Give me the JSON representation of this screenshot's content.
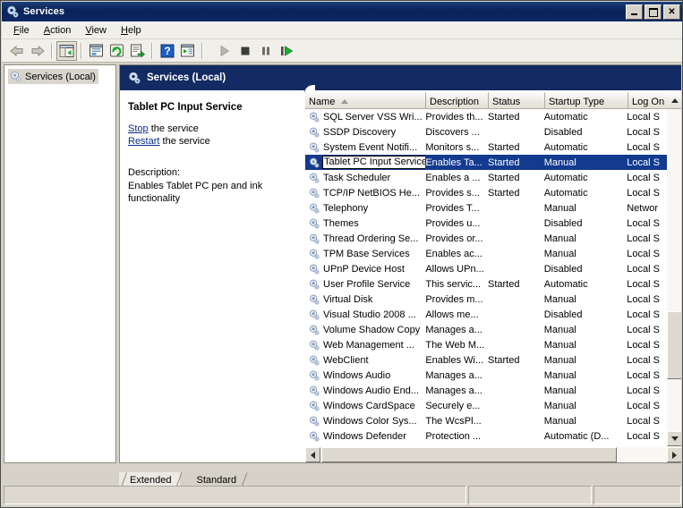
{
  "window": {
    "title": "Services",
    "icon": "services-gear-icon",
    "minimize_label": "Minimize",
    "maximize_label": "Maximize",
    "close_label": "Close"
  },
  "menu": {
    "items": [
      {
        "label": "File",
        "accel": "F"
      },
      {
        "label": "Action",
        "accel": "A"
      },
      {
        "label": "View",
        "accel": "V"
      },
      {
        "label": "Help",
        "accel": "H"
      }
    ]
  },
  "toolbar": {
    "buttons": [
      {
        "name": "back-icon",
        "label": "Back",
        "enabled": false
      },
      {
        "name": "forward-icon",
        "label": "Forward",
        "enabled": false
      },
      {
        "name": "show-hide-tree-icon",
        "label": "Show/Hide Console Tree",
        "enabled": true
      },
      {
        "name": "properties-icon",
        "label": "Properties",
        "enabled": true
      },
      {
        "name": "refresh-icon",
        "label": "Refresh",
        "enabled": true
      },
      {
        "name": "export-list-icon",
        "label": "Export List",
        "enabled": true
      },
      {
        "name": "help-icon",
        "label": "Help",
        "enabled": true
      },
      {
        "name": "new-window-icon",
        "label": "New Window from Here",
        "enabled": true
      },
      {
        "name": "start-service-icon",
        "label": "Start Service",
        "enabled": false
      },
      {
        "name": "stop-service-icon",
        "label": "Stop Service",
        "enabled": false
      },
      {
        "name": "pause-service-icon",
        "label": "Pause Service",
        "enabled": false
      },
      {
        "name": "restart-service-icon",
        "label": "Restart Service",
        "enabled": true
      }
    ]
  },
  "tree": {
    "root_label": "Services (Local)",
    "root_icon": "services-gear-icon"
  },
  "right_panel": {
    "header_title": "Services (Local)",
    "header_icon": "services-gear-icon",
    "header_bg": "#132b62",
    "selected_service_title": "Tablet PC Input Service",
    "actions": [
      {
        "link": "Stop",
        "suffix": " the service"
      },
      {
        "link": "Restart",
        "suffix": " the service"
      }
    ],
    "description_label": "Description:",
    "description_text": "Enables Tablet PC pen and ink functionality"
  },
  "list": {
    "columns": [
      {
        "key": "name",
        "label": "Name",
        "sort": "asc"
      },
      {
        "key": "description",
        "label": "Description",
        "sort": ""
      },
      {
        "key": "status",
        "label": "Status",
        "sort": ""
      },
      {
        "key": "startup",
        "label": "Startup Type",
        "sort": ""
      },
      {
        "key": "logon",
        "label": "Log On",
        "sort": ""
      }
    ],
    "rows": [
      {
        "name": "SQL Server VSS Wri...",
        "description": "Provides th...",
        "status": "Started",
        "startup": "Automatic",
        "logon": "Local S",
        "selected": false
      },
      {
        "name": "SSDP Discovery",
        "description": "Discovers ...",
        "status": "",
        "startup": "Disabled",
        "logon": "Local S",
        "selected": false
      },
      {
        "name": "System Event Notifi...",
        "description": "Monitors s...",
        "status": "Started",
        "startup": "Automatic",
        "logon": "Local S",
        "selected": false
      },
      {
        "name": "Tablet PC Input Service",
        "description": "Enables Ta...",
        "status": "Started",
        "startup": "Manual",
        "logon": "Local S",
        "selected": true
      },
      {
        "name": "Task Scheduler",
        "description": "Enables a ...",
        "status": "Started",
        "startup": "Automatic",
        "logon": "Local S",
        "selected": false
      },
      {
        "name": "TCP/IP NetBIOS He...",
        "description": "Provides s...",
        "status": "Started",
        "startup": "Automatic",
        "logon": "Local S",
        "selected": false
      },
      {
        "name": "Telephony",
        "description": "Provides T...",
        "status": "",
        "startup": "Manual",
        "logon": "Networ",
        "selected": false
      },
      {
        "name": "Themes",
        "description": "Provides u...",
        "status": "",
        "startup": "Disabled",
        "logon": "Local S",
        "selected": false
      },
      {
        "name": "Thread Ordering Se...",
        "description": "Provides or...",
        "status": "",
        "startup": "Manual",
        "logon": "Local S",
        "selected": false
      },
      {
        "name": "TPM Base Services",
        "description": "Enables ac...",
        "status": "",
        "startup": "Manual",
        "logon": "Local S",
        "selected": false
      },
      {
        "name": "UPnP Device Host",
        "description": "Allows UPn...",
        "status": "",
        "startup": "Disabled",
        "logon": "Local S",
        "selected": false
      },
      {
        "name": "User Profile Service",
        "description": "This servic...",
        "status": "Started",
        "startup": "Automatic",
        "logon": "Local S",
        "selected": false
      },
      {
        "name": "Virtual Disk",
        "description": "Provides m...",
        "status": "",
        "startup": "Manual",
        "logon": "Local S",
        "selected": false
      },
      {
        "name": "Visual Studio 2008 ...",
        "description": "Allows me...",
        "status": "",
        "startup": "Disabled",
        "logon": "Local S",
        "selected": false
      },
      {
        "name": "Volume Shadow Copy",
        "description": "Manages a...",
        "status": "",
        "startup": "Manual",
        "logon": "Local S",
        "selected": false
      },
      {
        "name": "Web Management ...",
        "description": "The Web M...",
        "status": "",
        "startup": "Manual",
        "logon": "Local S",
        "selected": false
      },
      {
        "name": "WebClient",
        "description": "Enables Wi...",
        "status": "Started",
        "startup": "Manual",
        "logon": "Local S",
        "selected": false
      },
      {
        "name": "Windows Audio",
        "description": "Manages a...",
        "status": "",
        "startup": "Manual",
        "logon": "Local S",
        "selected": false
      },
      {
        "name": "Windows Audio End...",
        "description": "Manages a...",
        "status": "",
        "startup": "Manual",
        "logon": "Local S",
        "selected": false
      },
      {
        "name": "Windows CardSpace",
        "description": "Securely e...",
        "status": "",
        "startup": "Manual",
        "logon": "Local S",
        "selected": false
      },
      {
        "name": "Windows Color Sys...",
        "description": "The WcsPl...",
        "status": "",
        "startup": "Manual",
        "logon": "Local S",
        "selected": false
      },
      {
        "name": "Windows Defender",
        "description": "Protection ...",
        "status": "",
        "startup": "Automatic (D...",
        "logon": "Local S",
        "selected": false
      }
    ],
    "row_icon": "service-gear-icon"
  },
  "tabs": [
    {
      "label": "Extended",
      "active": true
    },
    {
      "label": "Standard",
      "active": false
    }
  ],
  "statusbar": {
    "panes": [
      "",
      "",
      ""
    ]
  },
  "colors": {
    "titlebar_blue": "#0a2258",
    "panel_header_blue": "#132b62",
    "selection_blue": "#123a8f",
    "link_blue": "#0b2e8a",
    "chrome_gray": "#d6d2c8"
  }
}
